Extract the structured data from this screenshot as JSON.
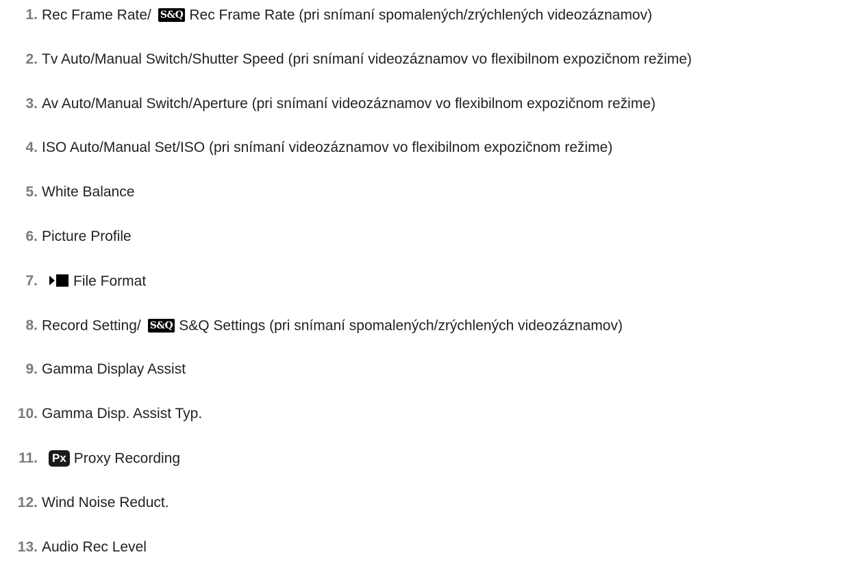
{
  "items": [
    {
      "num": "1.",
      "before": "Rec Frame Rate/",
      "badge": "S&Q",
      "after": "Rec Frame Rate (pri snímaní spomalených/zrýchlených videozáznamov)"
    },
    {
      "num": "2.",
      "text": "Tv Auto/Manual Switch/Shutter Speed (pri snímaní videozáznamov vo flexibilnom expozičnom režime)"
    },
    {
      "num": "3.",
      "text": "Av Auto/Manual Switch/Aperture (pri snímaní videozáznamov vo flexibilnom expozičnom režime)"
    },
    {
      "num": "4.",
      "text": "ISO Auto/Manual Set/ISO (pri snímaní videozáznamov vo flexibilnom expozičnom režime)"
    },
    {
      "num": "5.",
      "text": "White Balance"
    },
    {
      "num": "6.",
      "text": "Picture Profile"
    },
    {
      "num": "7.",
      "icon": "movie-icon",
      "after": "File Format"
    },
    {
      "num": "8.",
      "before": "Record Setting/",
      "badge": "S&Q",
      "after": "S&Q Settings (pri snímaní spomalených/zrýchlených videozáznamov)"
    },
    {
      "num": "9.",
      "text": "Gamma Display Assist"
    },
    {
      "num": "10.",
      "text": "Gamma Disp. Assist Typ."
    },
    {
      "num": "11.",
      "badge": "Px",
      "after": "Proxy Recording"
    },
    {
      "num": "12.",
      "text": "Wind Noise Reduct."
    },
    {
      "num": "13.",
      "text": "Audio Rec Level"
    }
  ]
}
